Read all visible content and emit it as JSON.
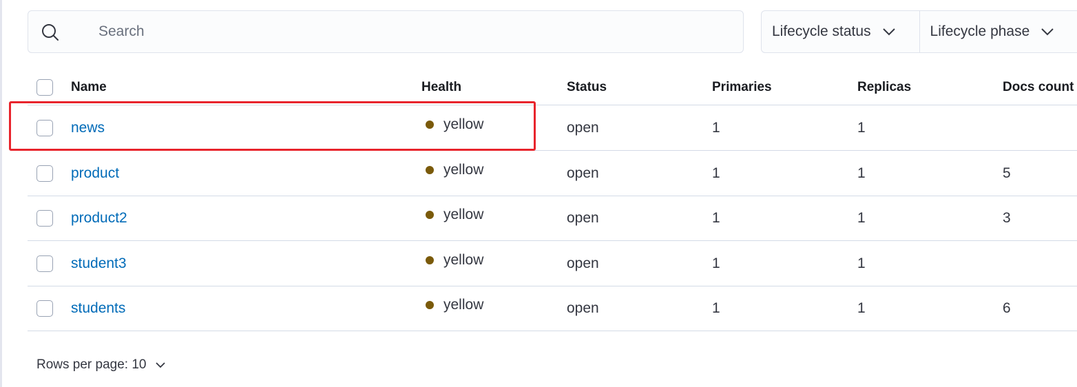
{
  "search": {
    "placeholder": "Search",
    "value": ""
  },
  "filters": [
    {
      "label": "Lifecycle status"
    },
    {
      "label": "Lifecycle phase"
    }
  ],
  "table": {
    "columns": {
      "name": "Name",
      "health": "Health",
      "status": "Status",
      "primaries": "Primaries",
      "replicas": "Replicas",
      "docs_count": "Docs count"
    },
    "rows": [
      {
        "name": "news",
        "health": "yellow",
        "status": "open",
        "primaries": "1",
        "replicas": "1",
        "docs_count": ""
      },
      {
        "name": "product",
        "health": "yellow",
        "status": "open",
        "primaries": "1",
        "replicas": "1",
        "docs_count": "5"
      },
      {
        "name": "product2",
        "health": "yellow",
        "status": "open",
        "primaries": "1",
        "replicas": "1",
        "docs_count": "3"
      },
      {
        "name": "student3",
        "health": "yellow",
        "status": "open",
        "primaries": "1",
        "replicas": "1",
        "docs_count": ""
      },
      {
        "name": "students",
        "health": "yellow",
        "status": "open",
        "primaries": "1",
        "replicas": "1",
        "docs_count": "6"
      }
    ]
  },
  "pagination": {
    "rows_per_page_label": "Rows per page: 10"
  },
  "colors": {
    "health_yellow": "#7a5a0a",
    "link": "#006bb8",
    "highlight": "#e8242c"
  },
  "icons": {
    "search": "magnifier-icon",
    "dropdown": "chevron-down-icon"
  }
}
